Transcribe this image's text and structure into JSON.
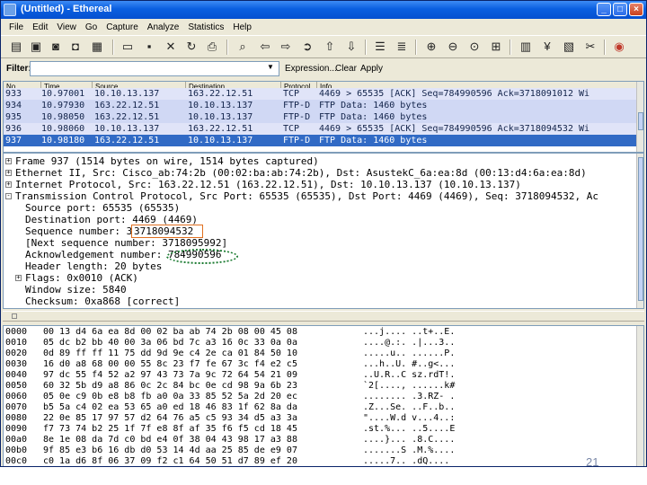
{
  "window": {
    "title": "(Untitled) - Ethereal",
    "minimize": "_",
    "maximize": "□",
    "close": "×"
  },
  "menu": [
    "File",
    "Edit",
    "View",
    "Go",
    "Capture",
    "Analyze",
    "Statistics",
    "Help"
  ],
  "toolbar_icons": [
    "list-interfaces-icon",
    "capture-options-icon",
    "start-capture-icon",
    "stop-capture-icon",
    "open-file-icon",
    "save-file-icon",
    "close-file-icon",
    "reload-icon",
    "print-icon",
    "find-packet-icon",
    "go-back-icon",
    "go-forward-icon",
    "go-to-packet-icon",
    "go-first-icon",
    "go-last-icon",
    "colorize-icon",
    "auto-scroll-icon",
    "zoom-in-icon",
    "zoom-out-icon",
    "zoom-normal-icon",
    "resize-columns-icon",
    "capture-filters-icon",
    "display-filters-icon",
    "coloring-rules-icon",
    "preferences-icon",
    "help-icon"
  ],
  "filter": {
    "label": "Filter:",
    "value": "",
    "expression": "Expression...",
    "clear": "Clear",
    "apply": "Apply"
  },
  "packet_list": {
    "columns": [
      "No. .",
      "Time",
      "Source",
      "Destination",
      "Protocol",
      "Info"
    ],
    "rows": [
      {
        "no": "933",
        "time": "10.97001",
        "source": "10.10.13.137",
        "destination": "163.22.12.51",
        "protocol": "TCP",
        "info": "4469 > 65535 [ACK] Seq=784990596 Ack=3718091012 Wi",
        "kind": "tcp"
      },
      {
        "no": "934",
        "time": "10.97930",
        "source": "163.22.12.51",
        "destination": "10.10.13.137",
        "protocol": "FTP-D",
        "info": "FTP Data: 1460 bytes",
        "kind": "ftp"
      },
      {
        "no": "935",
        "time": "10.98050",
        "source": "163.22.12.51",
        "destination": "10.10.13.137",
        "protocol": "FTP-D",
        "info": "FTP Data: 1460 bytes",
        "kind": "ftp"
      },
      {
        "no": "936",
        "time": "10.98060",
        "source": "10.10.13.137",
        "destination": "163.22.12.51",
        "protocol": "TCP",
        "info": "4469 > 65535 [ACK] Seq=784990596 Ack=3718094532 Wi",
        "kind": "tcp"
      },
      {
        "no": "937",
        "time": "10.98180",
        "source": "163.22.12.51",
        "destination": "10.10.13.137",
        "protocol": "FTP-D",
        "info": "FTP Data: 1460 bytes",
        "kind": "selected"
      }
    ]
  },
  "details": [
    {
      "indent": 0,
      "expander": "+",
      "text": "Frame 937 (1514 bytes on wire, 1514 bytes captured)"
    },
    {
      "indent": 0,
      "expander": "+",
      "text": "Ethernet II, Src: Cisco_ab:74:2b (00:02:ba:ab:74:2b), Dst: AsustekC_6a:ea:8d (00:13:d4:6a:ea:8d)"
    },
    {
      "indent": 0,
      "expander": "+",
      "text": "Internet Protocol, Src: 163.22.12.51 (163.22.12.51), Dst: 10.10.13.137 (10.10.13.137)"
    },
    {
      "indent": 0,
      "expander": "-",
      "text": "Transmission Control Protocol, Src Port: 65535 (65535), Dst Port: 4469 (4469), Seq: 3718094532, Ac"
    },
    {
      "indent": 1,
      "expander": "",
      "text": "Source port: 65535 (65535)"
    },
    {
      "indent": 1,
      "expander": "",
      "text": "Destination port: 4469 (4469)"
    },
    {
      "indent": 1,
      "expander": "",
      "text": "Sequence number: 3718094532"
    },
    {
      "indent": 1,
      "expander": "",
      "text": "[Next sequence number: 3718095992]"
    },
    {
      "indent": 1,
      "expander": "",
      "text": "Acknowledgement number: 784990596"
    },
    {
      "indent": 1,
      "expander": "",
      "text": "Header length: 20 bytes"
    },
    {
      "indent": 1,
      "expander": "+",
      "text": "Flags: 0x0010 (ACK)"
    },
    {
      "indent": 1,
      "expander": "",
      "text": "Window size: 5840"
    },
    {
      "indent": 1,
      "expander": "",
      "text": "Checksum: 0xa868 [correct]"
    }
  ],
  "annotations": {
    "sequence_box": "3718094532",
    "ack_oval": "784990596"
  },
  "hex": [
    {
      "offset": "0000",
      "bytes": "00 13 d4 6a ea 8d 00 02  ba ab 74 2b 08 00 45 08",
      "ascii": "...j.... ..t+..E."
    },
    {
      "offset": "0010",
      "bytes": "05 dc b2 bb 40 00 3a 06  bd 7c a3 16 0c 33 0a 0a",
      "ascii": "....@.:. .|...3.."
    },
    {
      "offset": "0020",
      "bytes": "0d 89 ff ff 11 75 dd 9d  9e c4 2e ca 01 84 50 10",
      "ascii": ".....u.. ......P."
    },
    {
      "offset": "0030",
      "bytes": "16 d0 a8 68 00 00 55 8c  23 f7 fe 67 3c f4 e2 c5",
      "ascii": "...h..U. #..g<..."
    },
    {
      "offset": "0040",
      "bytes": "97 dc 55 f4 52 a2 97 43  73 7a 9c 72 64 54 21 09",
      "ascii": "..U.R..C sz.rdT!."
    },
    {
      "offset": "0050",
      "bytes": "60 32 5b d9 a8 86 0c 2c  84 bc 0e cd 98 9a 6b 23",
      "ascii": "`2[....,  ......k#"
    },
    {
      "offset": "0060",
      "bytes": "05 0e c9 0b e8 b8 fb a0  0a 33 85 52 5a 2d 20 ec",
      "ascii": "........ .3.RZ- ."
    },
    {
      "offset": "0070",
      "bytes": "b5 5a c4 02 ea 53 65 a0  ed 18 46 83 1f 62 8a da",
      "ascii": ".Z...Se. ..F..b.."
    },
    {
      "offset": "0080",
      "bytes": "22 0e 85 17 97 57 d2 64  76 a5 c5 93 34 d5 a3 3a",
      "ascii": "\"....W.d v...4..:"
    },
    {
      "offset": "0090",
      "bytes": "f7 73 74 b2 25 1f 7f e8  8f af 35 f6 f5 cd 18 45",
      "ascii": ".st.%... ..5....E"
    },
    {
      "offset": "00a0",
      "bytes": "8e 1e 08 da 7d c0 bd e4  0f 38 04 43 98 17 a3 88",
      "ascii": "....}... .8.C...."
    },
    {
      "offset": "00b0",
      "bytes": "9f 85 e3 b6 16 db d0 53  14 4d aa 25 85 de e9 07",
      "ascii": ".......S .M.%...."
    },
    {
      "offset": "00c0",
      "bytes": "c0 1a d6 8f 06 37 09 f2  c1 64 50 51 d7 89 ef 20",
      "ascii": ".....7.. .dQ.... "
    }
  ],
  "page_number": "21"
}
